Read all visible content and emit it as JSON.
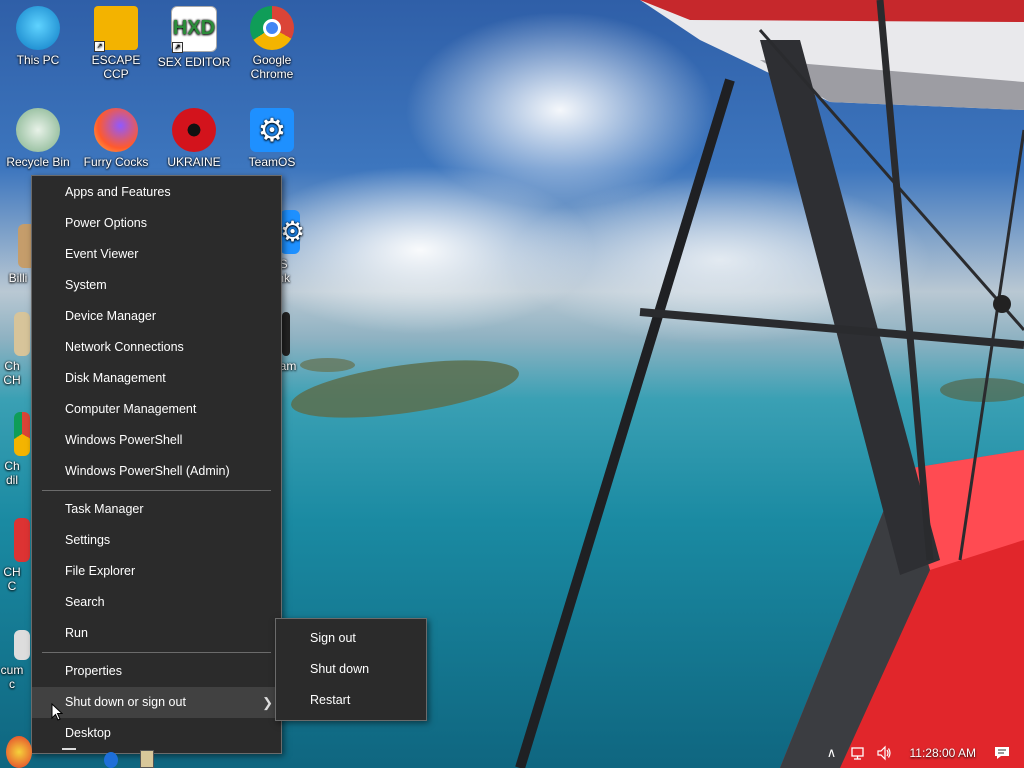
{
  "desktop": {
    "icons": [
      {
        "label": "This PC",
        "icon": "computer-icon"
      },
      {
        "label": "ESCAPE CCP",
        "icon": "folder-icon"
      },
      {
        "label": "SEX EDITOR",
        "icon": "hxd-icon"
      },
      {
        "label": "Google Chrome",
        "icon": "chrome-icon"
      },
      {
        "label": "Recycle Bin",
        "icon": "recycle-bin-icon"
      },
      {
        "label": "Furry Cocks",
        "icon": "firefox-icon"
      },
      {
        "label": "UKRAINE",
        "icon": "radiation-icon"
      },
      {
        "label": "TeamOS",
        "icon": "gear-icon"
      },
      {
        "label": "Billi",
        "icon": "app-icon"
      },
      {
        "label": "OS",
        "icon": "gear-icon"
      },
      {
        "label": "Link",
        "icon": "link-icon"
      },
      {
        "label": "Ch",
        "icon": "app-icon"
      },
      {
        "label": "CH",
        "icon": "app-icon"
      },
      {
        "label": "am",
        "icon": "app-icon"
      },
      {
        "label": "Ch",
        "icon": "app-icon"
      },
      {
        "label": "dil",
        "icon": "app-icon"
      },
      {
        "label": "CH",
        "icon": "app-icon"
      },
      {
        "label": "C",
        "icon": "app-icon"
      },
      {
        "label": "cum",
        "icon": "app-icon"
      },
      {
        "label": "c",
        "icon": "app-icon"
      }
    ]
  },
  "context_menu": {
    "group1": [
      "Apps and Features",
      "Power Options",
      "Event Viewer",
      "System",
      "Device Manager",
      "Network Connections",
      "Disk Management",
      "Computer Management",
      "Windows PowerShell",
      "Windows PowerShell (Admin)"
    ],
    "group2": [
      "Task Manager",
      "Settings",
      "File Explorer",
      "Search",
      "Run"
    ],
    "group3": [
      "Properties",
      "Shut down or sign out",
      "Desktop"
    ],
    "highlighted": "Shut down or sign out"
  },
  "submenu": {
    "items": [
      "Sign out",
      "Shut down",
      "Restart"
    ]
  },
  "taskbar": {
    "clock": "11:28:00 AM",
    "tray_icons": [
      "chevron-up-icon",
      "network-icon",
      "speaker-icon",
      "notification-icon"
    ]
  },
  "colors": {
    "menu_bg": "#2b2b2b",
    "menu_hover": "#414141",
    "menu_border": "#6b6b6b",
    "plane_red": "#e1262b"
  }
}
